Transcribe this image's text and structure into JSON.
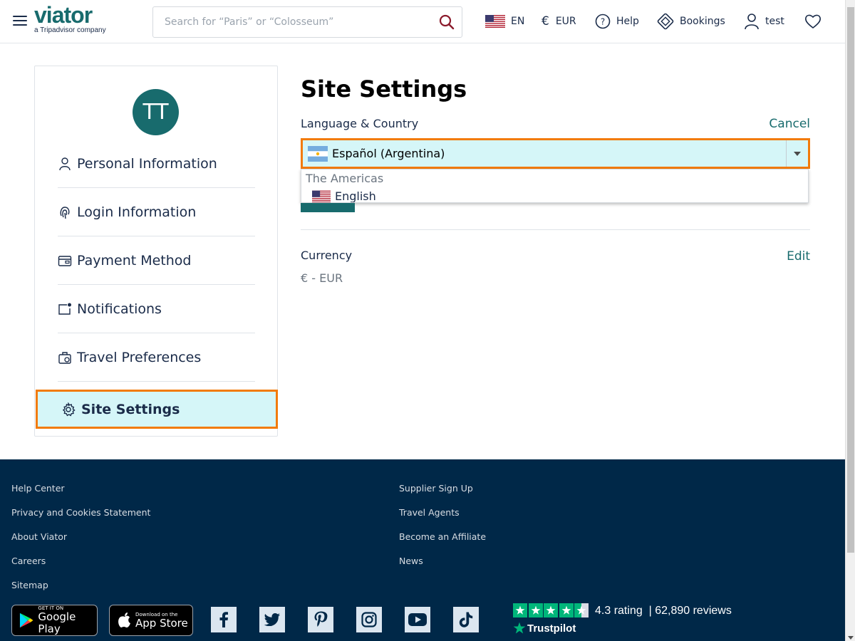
{
  "header": {
    "logo_text": "viator",
    "logo_sub": "a Tripadvisor company",
    "search_placeholder": "Search for “Paris” or “Colosseum”",
    "language": "EN",
    "currency": "EUR",
    "help": "Help",
    "bookings": "Bookings",
    "user": "test"
  },
  "sidebar": {
    "avatar_initials": "TT",
    "items": [
      {
        "label": "Personal Information",
        "icon": "person-icon"
      },
      {
        "label": "Login Information",
        "icon": "fingerprint-icon"
      },
      {
        "label": "Payment Method",
        "icon": "wallet-icon"
      },
      {
        "label": "Notifications",
        "icon": "notification-icon"
      },
      {
        "label": "Travel Preferences",
        "icon": "luggage-icon"
      }
    ],
    "active": {
      "label": "Site Settings",
      "icon": "gear-icon"
    }
  },
  "main": {
    "title": "Site Settings",
    "language_section": {
      "label": "Language & Country",
      "cancel": "Cancel",
      "selected_value": "Español (Argentina)",
      "dropdown_group": "The Americas",
      "dropdown_option": "English"
    },
    "currency_section": {
      "label": "Currency",
      "edit": "Edit",
      "value": "€ - EUR"
    }
  },
  "footer": {
    "col1": [
      "Help Center",
      "Privacy and Cookies Statement",
      "About Viator",
      "Careers",
      "Sitemap"
    ],
    "col2": [
      "Supplier Sign Up",
      "Travel Agents",
      "Become an Affiliate",
      "News"
    ],
    "google_play": {
      "small": "GET IT ON",
      "big": "Google Play"
    },
    "app_store": {
      "small": "Download on the",
      "big": "App Store"
    },
    "social": [
      "facebook-icon",
      "twitter-icon",
      "pinterest-icon",
      "instagram-icon",
      "youtube-icon",
      "tiktok-icon"
    ],
    "rating_text": "4.3 rating  | 62,890 reviews",
    "trustpilot": "Trustpilot"
  },
  "colors": {
    "brand": "#186b6d",
    "highlight": "#d5f6f8",
    "focus": "#f27b0b",
    "footer_bg": "#002848",
    "trustpilot_green": "#00b67a"
  }
}
